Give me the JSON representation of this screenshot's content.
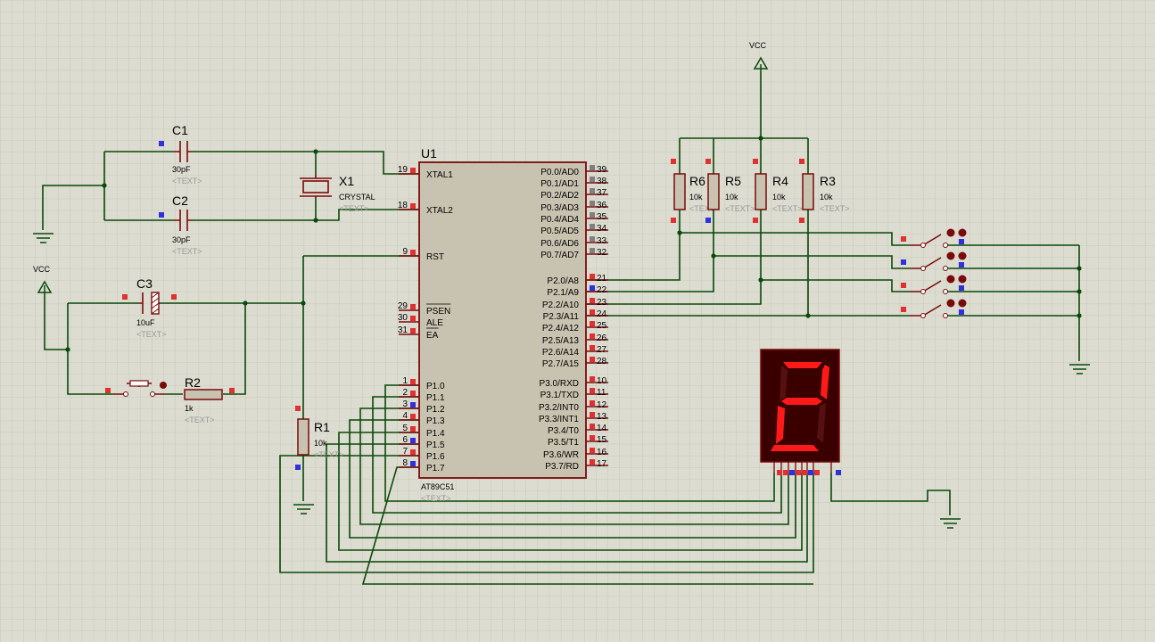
{
  "power": {
    "vcc_left": "VCC",
    "vcc_right": "VCC"
  },
  "mcu": {
    "ref": "U1",
    "part": "AT89C51",
    "text": "<TEXT>",
    "left_pins": [
      {
        "num": "19",
        "name": "XTAL1"
      },
      {
        "num": "18",
        "name": "XTAL2"
      },
      {
        "num": "9",
        "name": "RST"
      },
      {
        "num": "29",
        "name": "PSEN"
      },
      {
        "num": "30",
        "name": "ALE"
      },
      {
        "num": "31",
        "name": "EA"
      },
      {
        "num": "1",
        "name": "P1.0"
      },
      {
        "num": "2",
        "name": "P1.1"
      },
      {
        "num": "3",
        "name": "P1.2"
      },
      {
        "num": "4",
        "name": "P1.3"
      },
      {
        "num": "5",
        "name": "P1.4"
      },
      {
        "num": "6",
        "name": "P1.5"
      },
      {
        "num": "7",
        "name": "P1.6"
      },
      {
        "num": "8",
        "name": "P1.7"
      }
    ],
    "right_pins": [
      {
        "num": "39",
        "name": "P0.0/AD0"
      },
      {
        "num": "38",
        "name": "P0.1/AD1"
      },
      {
        "num": "37",
        "name": "P0.2/AD2"
      },
      {
        "num": "36",
        "name": "P0.3/AD3"
      },
      {
        "num": "35",
        "name": "P0.4/AD4"
      },
      {
        "num": "34",
        "name": "P0.5/AD5"
      },
      {
        "num": "33",
        "name": "P0.6/AD6"
      },
      {
        "num": "32",
        "name": "P0.7/AD7"
      },
      {
        "num": "21",
        "name": "P2.0/A8"
      },
      {
        "num": "22",
        "name": "P2.1/A9"
      },
      {
        "num": "23",
        "name": "P2.2/A10"
      },
      {
        "num": "24",
        "name": "P2.3/A11"
      },
      {
        "num": "25",
        "name": "P2.4/A12"
      },
      {
        "num": "26",
        "name": "P2.5/A13"
      },
      {
        "num": "27",
        "name": "P2.6/A14"
      },
      {
        "num": "28",
        "name": "P2.7/A15"
      },
      {
        "num": "10",
        "name": "P3.0/RXD"
      },
      {
        "num": "11",
        "name": "P3.1/TXD"
      },
      {
        "num": "12",
        "name": "P3.2/INT0"
      },
      {
        "num": "13",
        "name": "P3.3/INT1"
      },
      {
        "num": "14",
        "name": "P3.4/T0"
      },
      {
        "num": "15",
        "name": "P3.5/T1"
      },
      {
        "num": "16",
        "name": "P3.6/WR"
      },
      {
        "num": "17",
        "name": "P3.7/RD"
      }
    ]
  },
  "parts": {
    "c1": {
      "ref": "C1",
      "value": "30pF",
      "text": "<TEXT>"
    },
    "c2": {
      "ref": "C2",
      "value": "30pF",
      "text": "<TEXT>"
    },
    "c3": {
      "ref": "C3",
      "value": "10uF",
      "text": "<TEXT>"
    },
    "x1": {
      "ref": "X1",
      "value": "CRYSTAL",
      "text": "<TEXT>"
    },
    "r1": {
      "ref": "R1",
      "value": "10k",
      "text": "<TEXT>"
    },
    "r2": {
      "ref": "R2",
      "value": "1k",
      "text": "<TEXT>"
    },
    "r3": {
      "ref": "R3",
      "value": "10k",
      "text": "<TEXT>"
    },
    "r4": {
      "ref": "R4",
      "value": "10k",
      "text": "<TEXT>"
    },
    "r5": {
      "ref": "R5",
      "value": "10k",
      "text": "<TEXT>"
    },
    "r6": {
      "ref": "R6",
      "value": "10k",
      "text": "<TEXT>"
    }
  },
  "display": {
    "digit": "2",
    "segment_color": "#ff1a1a",
    "body_color": "#3a0000"
  },
  "colors": {
    "wire": "#0a4a0a",
    "component": "#7a0a0a",
    "chip_fill": "#c8c3b0",
    "pin_red": "#e03030",
    "pin_blue": "#3030e0"
  }
}
